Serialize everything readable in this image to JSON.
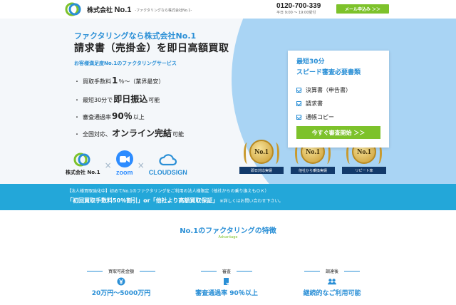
{
  "header": {
    "company_prefix": "株式会社",
    "company_name": "No.1",
    "tagline": "-ファクタリングなら株式会社No.1-",
    "tel": "0120-700-339",
    "hours": "平日 9:00 ～ 19:00受付",
    "mail_button": "メール申込み ＞＞",
    "colors": {
      "accent": "#2a8fd6",
      "green": "#7dc22b"
    }
  },
  "hero": {
    "sub": "ファクタリングなら株式会社No.1",
    "title": "請求書（売掛金）を即日高額買取",
    "small": "お客様満足度No.1のファクタリングサービス",
    "points": [
      {
        "pre": "買取手数料 ",
        "big": "1",
        "post": "％～（業界最安）"
      },
      {
        "pre": "最短30分で",
        "big": "即日振込",
        "post": "可能"
      },
      {
        "pre": "審査通過率",
        "big": "90％",
        "post": "以上"
      },
      {
        "pre": "全国対応、",
        "big": "オンライン完結",
        "post": "可能"
      }
    ],
    "brands": {
      "no1": "株式会社 No.1",
      "zoom": "zoom",
      "cloudsign": "CLOUDSIGN",
      "times": "×"
    },
    "badges": [
      {
        "medal": "No.1",
        "ribbon": "即日対応実績"
      },
      {
        "medal": "No.1",
        "ribbon": "他社から乗換実績"
      },
      {
        "medal": "No.1",
        "ribbon": "リピート率"
      }
    ]
  },
  "card": {
    "h1": "最短30分",
    "h2": "スピード審査必要書類",
    "items": [
      "決算書（申告書）",
      "請求書",
      "通帳コピー"
    ],
    "button": "今すぐ審査開始 ＞＞"
  },
  "banner": {
    "line1": "【法人様買取強化中】初めてNo.1のファクタリングをご利用の法人様限定（他社からの乗り換えもＯＫ）",
    "line2": "「初回買取手数料50％割引」or「他社より高額買取保証」",
    "note": "※詳しくはお問い合わせ下さい。"
  },
  "features": {
    "title": "No.1のファクタリングの特徴",
    "sub": "Advantage",
    "items": [
      {
        "label": "買取可能金額",
        "icon": "yen-coin-icon",
        "value": "20万円～5000万円"
      },
      {
        "label": "審査",
        "icon": "document-check-icon",
        "value": "審査通過率 90％以上"
      },
      {
        "label": "調達後",
        "icon": "people-icon",
        "value": "継続的なご利用可能"
      }
    ]
  }
}
